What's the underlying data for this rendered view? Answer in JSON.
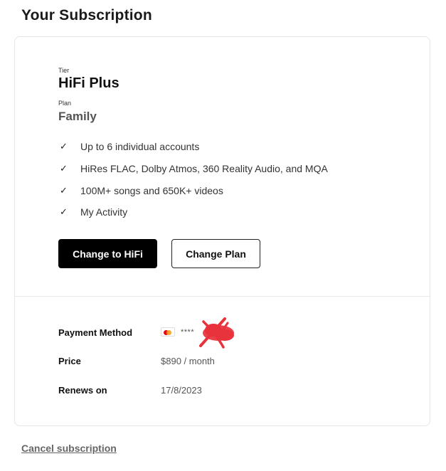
{
  "page": {
    "title": "Your Subscription"
  },
  "subscription": {
    "tier_label": "Tier",
    "tier_name": "HiFi Plus",
    "plan_label": "Plan",
    "plan_name": "Family",
    "features": [
      "Up to 6 individual accounts",
      "HiRes FLAC, Dolby Atmos, 360 Reality Audio, and MQA",
      "100M+ songs and 650K+ videos",
      "My Activity"
    ],
    "check_icon": "✓",
    "primary_button_label": "Change to HiFi",
    "secondary_button_label": "Change Plan"
  },
  "details": {
    "payment_method_label": "Payment Method",
    "payment_card_brand": "mastercard-icon",
    "payment_masked": "****",
    "price_label": "Price",
    "price_value": "$890 / month",
    "renews_label": "Renews on",
    "renews_value": "17/8/2023"
  },
  "footer": {
    "cancel_label": "Cancel subscription"
  },
  "colors": {
    "primary_button_bg": "#000000",
    "redaction": "#e8323c",
    "mastercard_red": "#eb001b",
    "mastercard_orange": "#f79e1b"
  }
}
